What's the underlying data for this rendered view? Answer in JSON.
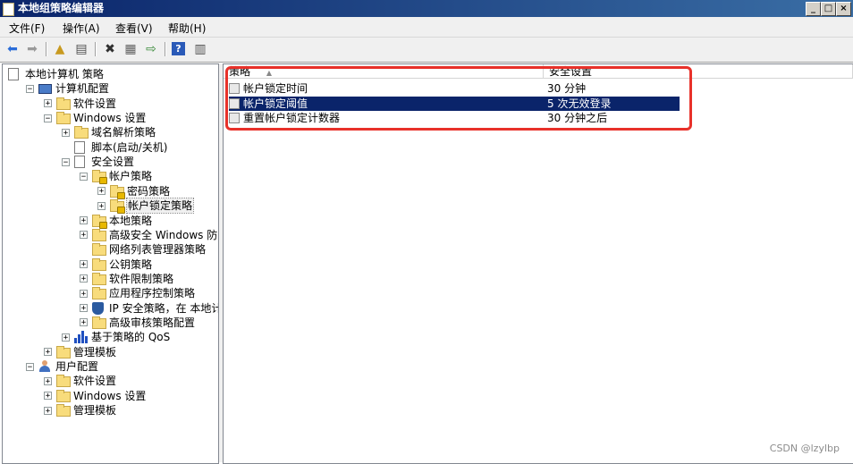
{
  "window": {
    "title": "本地组策略编辑器",
    "buttons": [
      "_",
      "□",
      "×"
    ]
  },
  "menu": [
    "文件(F)",
    "操作(A)",
    "查看(V)",
    "帮助(H)"
  ],
  "toolbar_icons": [
    "back-arrow-icon",
    "forward-arrow-icon",
    "up-folder-icon",
    "show-hide-tree-icon",
    "delete-icon",
    "properties-icon",
    "export-list-icon",
    "help-icon",
    "view-icon"
  ],
  "tree": [
    {
      "label": "本地计算机 策略",
      "icon": "doc",
      "expander": "",
      "indent": 0
    },
    {
      "label": "计算机配置",
      "icon": "pc",
      "expander": "−",
      "indent": 1
    },
    {
      "label": "软件设置",
      "icon": "folder",
      "expander": "+",
      "indent": 2
    },
    {
      "label": "Windows 设置",
      "icon": "folder",
      "expander": "−",
      "indent": 2
    },
    {
      "label": "域名解析策略",
      "icon": "folder",
      "expander": "+",
      "indent": 3
    },
    {
      "label": "脚本(启动/关机)",
      "icon": "doc",
      "expander": "",
      "indent": 3
    },
    {
      "label": "安全设置",
      "icon": "doc",
      "expander": "−",
      "indent": 3
    },
    {
      "label": "帐户策略",
      "icon": "lockfolder",
      "expander": "−",
      "indent": 4
    },
    {
      "label": "密码策略",
      "icon": "lockfolder",
      "expander": "+",
      "indent": 5
    },
    {
      "label": "帐户锁定策略",
      "icon": "lockfolder",
      "expander": "+",
      "indent": 5,
      "highlight": true
    },
    {
      "label": "本地策略",
      "icon": "lockfolder",
      "expander": "+",
      "indent": 4
    },
    {
      "label": "高级安全 Windows 防火墙",
      "icon": "folder",
      "expander": "+",
      "indent": 4
    },
    {
      "label": "网络列表管理器策略",
      "icon": "folder",
      "expander": "",
      "indent": 4
    },
    {
      "label": "公钥策略",
      "icon": "folder",
      "expander": "+",
      "indent": 4
    },
    {
      "label": "软件限制策略",
      "icon": "folder",
      "expander": "+",
      "indent": 4
    },
    {
      "label": "应用程序控制策略",
      "icon": "folder",
      "expander": "+",
      "indent": 4
    },
    {
      "label": "IP 安全策略，在 本地计算机",
      "icon": "shield",
      "expander": "+",
      "indent": 4
    },
    {
      "label": "高级审核策略配置",
      "icon": "folder",
      "expander": "+",
      "indent": 4
    },
    {
      "label": "基于策略的 QoS",
      "icon": "bars",
      "expander": "+",
      "indent": 3
    },
    {
      "label": "管理模板",
      "icon": "folder",
      "expander": "+",
      "indent": 2
    },
    {
      "label": "用户配置",
      "icon": "user",
      "expander": "−",
      "indent": 1
    },
    {
      "label": "软件设置",
      "icon": "folder",
      "expander": "+",
      "indent": 2
    },
    {
      "label": "Windows 设置",
      "icon": "folder",
      "expander": "+",
      "indent": 2
    },
    {
      "label": "管理模板",
      "icon": "folder",
      "expander": "+",
      "indent": 2
    }
  ],
  "list": {
    "columns": [
      "策略",
      "安全设置"
    ],
    "rows": [
      {
        "policy": "帐户锁定时间",
        "setting": "30 分钟",
        "selected": false
      },
      {
        "policy": "帐户锁定阈值",
        "setting": "5 次无效登录",
        "selected": true
      },
      {
        "policy": "重置帐户锁定计数器",
        "setting": "30 分钟之后",
        "selected": false
      }
    ]
  },
  "watermark": "CSDN @lzylbp",
  "colors": {
    "selection": "#0a246a",
    "annotation_box": "#e8312a",
    "titlebar": "#0a246a"
  }
}
